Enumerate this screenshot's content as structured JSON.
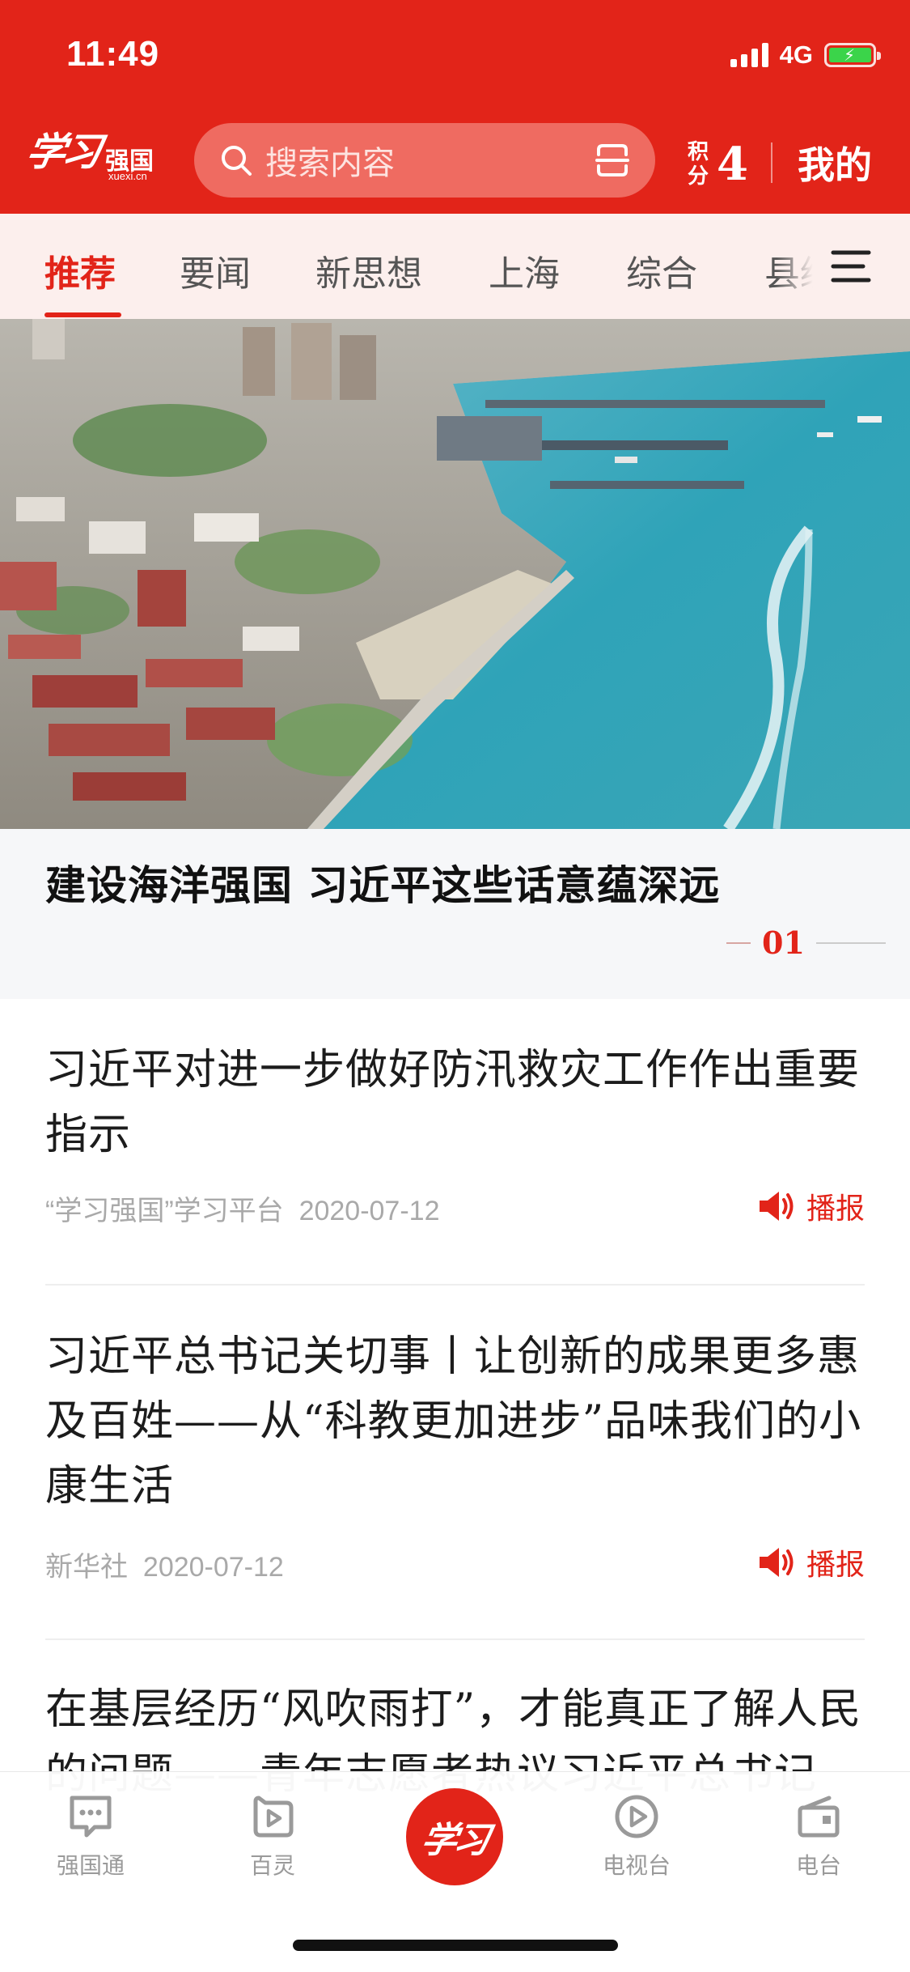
{
  "status_bar": {
    "time": "11:49",
    "network": "4G"
  },
  "header": {
    "logo_script": "学习",
    "logo_text": "强国",
    "logo_sub": "xuexi.cn",
    "search_placeholder": "搜索内容",
    "points_label_1": "积",
    "points_label_2": "分",
    "points_value": "4",
    "mine_label": "我的"
  },
  "tabs": [
    {
      "label": "推荐",
      "active": true
    },
    {
      "label": "要闻"
    },
    {
      "label": "新思想"
    },
    {
      "label": "上海"
    },
    {
      "label": "综合"
    },
    {
      "label": "县级"
    }
  ],
  "hero": {
    "title": "建设海洋强国  习近平这些话意蕴深远",
    "index": "01"
  },
  "news": [
    {
      "title": "习近平对进一步做好防汛救灾工作作出重要指示",
      "source": "“学习强国”学习平台",
      "date": "2020-07-12",
      "broadcast_label": "播报"
    },
    {
      "title": "习近平总书记关切事丨让创新的成果更多惠及百姓——从“科教更加进步”品味我们的小康生活",
      "source": "新华社",
      "date": "2020-07-12",
      "broadcast_label": "播报"
    },
    {
      "title": "在基层经历“风吹雨打”，才能真正了解人民的问题——青年志愿者热议习近平总书记"
    }
  ],
  "bottom_nav": [
    {
      "label": "强国通",
      "icon": "chat-icon"
    },
    {
      "label": "百灵",
      "icon": "bailing-icon"
    },
    {
      "label": "学习",
      "icon": "xuexi-logo"
    },
    {
      "label": "电视台",
      "icon": "tv-icon"
    },
    {
      "label": "电台",
      "icon": "radio-icon"
    }
  ],
  "colors": {
    "brand_red": "#e22419",
    "tab_bg": "#fcefed",
    "caption_bg": "#f6f7f9"
  }
}
